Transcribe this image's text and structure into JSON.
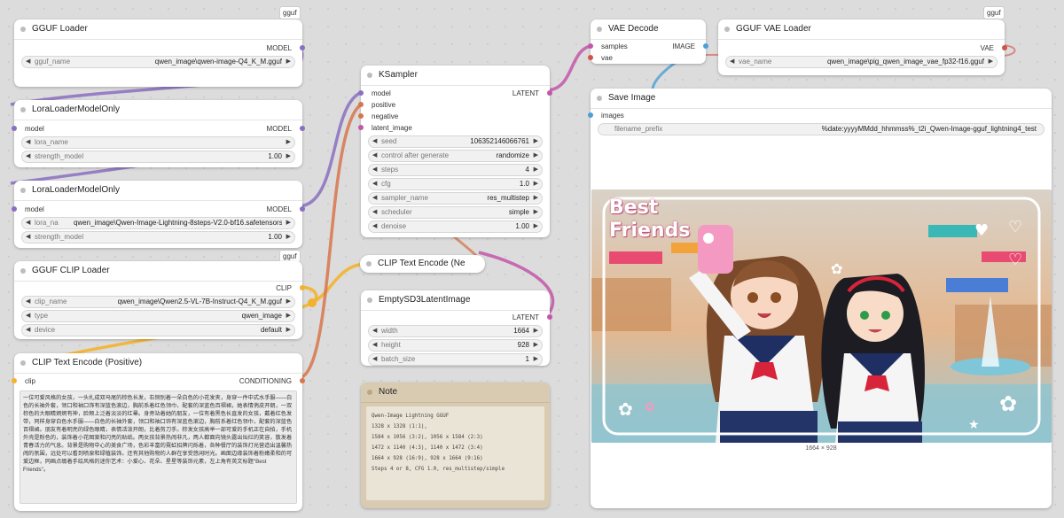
{
  "colors": {
    "model": "#8a6fc0",
    "clip": "#f3b22c",
    "conditioning": "#d7754b",
    "latent": "#c356a9",
    "vae": "#d45149",
    "image": "#4c9fd6"
  },
  "nodes": {
    "gguf_loader": {
      "badge": "gguf",
      "title": "GGUF Loader",
      "output": "MODEL",
      "widgets": [
        {
          "name": "gguf_name",
          "value": "qwen_image\\qwen-image-Q4_K_M.gguf"
        }
      ]
    },
    "lora1": {
      "title": "LoraLoaderModelOnly",
      "input": "model",
      "output": "MODEL",
      "widgets": [
        {
          "name": "lora_name",
          "value": ""
        },
        {
          "name": "strength_model",
          "value": "1.00"
        }
      ]
    },
    "lora2": {
      "title": "LoraLoaderModelOnly",
      "input": "model",
      "output": "MODEL",
      "widgets": [
        {
          "name": "lora_na",
          "value": "qwen_image\\Qwen-Image-Lightning-8steps-V2.0-bf16.safetensors"
        },
        {
          "name": "strength_model",
          "value": "1.00"
        }
      ]
    },
    "clip_loader": {
      "badge": "gguf",
      "title": "GGUF CLIP Loader",
      "output": "CLIP",
      "widgets": [
        {
          "name": "clip_name",
          "value": "qwen_image\\Qwen2.5-VL-7B-Instruct-Q4_K_M.gguf"
        },
        {
          "name": "type",
          "value": "qwen_image"
        },
        {
          "name": "device",
          "value": "default"
        }
      ]
    },
    "clip_positive": {
      "title": "CLIP Text Encode (Positive)",
      "input": "clip",
      "output": "CONDITIONING",
      "prompt": "一位可爱风格的女孩，一头扎成双马尾的棕色长发，右侧别着一朵白色的小花发夹，身穿一件中式水手服——白色的长袖外套，领口和袖口饰有深蓝色滚边，胸前系着红色领巾，配套的深蓝色百褶裙，她表情俏皮开朗，一双棕色的大眼睛炯炯有神，脸颊上泛着淡淡的红晕。身旁站着她的朋友，一位有着黑色长直发的女孩，戴着红色发带，同样身穿白色水手服——白色的长袖外套，领口和袖口饰有深蓝色滚边，胸前系着红色领巾，配套的深蓝色百褶裙。朋友有着明亮的绿色眼睛，表情活泼开朗，比着剪刀手。棕发女孩高举一部可爱的手机正在自拍，手机外壳是粉色的，装饰着小花图案和闪亮的贴纸。两女孩背景热闹非凡，两人都面向镜头露出灿烂的笑容，散发着青春活力的气息。背景是购物中心的美食广场，色彩丰富的霓虹招牌闪烁着，各种餐厅的装饰灯光营造出温馨热闹的氛围，远处可以看到喷泉和绿植装饰。还有其他购物的人群在享受悠闲时光。画面边缘装饰着粉嫩柔和的可爱边框，同画点缀着手绘风格的迷你艺术：小爱心、花朵、星星等装饰元素，左上角有英文标题\"Best Friends\"。"
    },
    "ksampler": {
      "title": "KSampler",
      "inputs": [
        "model",
        "positive",
        "negative",
        "latent_image"
      ],
      "output": "LATENT",
      "widgets": [
        {
          "name": "seed",
          "value": "106352146066761"
        },
        {
          "name": "control after generate",
          "value": "randomize"
        },
        {
          "name": "steps",
          "value": "4"
        },
        {
          "name": "cfg",
          "value": "1.0"
        },
        {
          "name": "sampler_name",
          "value": "res_multistep"
        },
        {
          "name": "scheduler",
          "value": "simple"
        },
        {
          "name": "denoise",
          "value": "1.00"
        }
      ]
    },
    "clip_negative": {
      "title": "CLIP Text Encode (Ne"
    },
    "empty_latent": {
      "title": "EmptySD3LatentImage",
      "output": "LATENT",
      "widgets": [
        {
          "name": "width",
          "value": "1664"
        },
        {
          "name": "height",
          "value": "928"
        },
        {
          "name": "batch_size",
          "value": "1"
        }
      ]
    },
    "note": {
      "title": "Note",
      "lines": [
        "Qwen-Image Lightning GGUF",
        "1328 x 1328 (1:1),",
        "1584 x 1056 (3:2),  1056 x 1584 (2:3)",
        "1472 x 1140 (4:3),  1140 x 1472 (3:4)",
        "1664 x  928 (16:9),  928 x 1664 (9:16)",
        "Steps 4 or 8, CFG 1.0, res_multistep/simple"
      ]
    },
    "vae_decode": {
      "title": "VAE Decode",
      "inputs": [
        "samples",
        "vae"
      ],
      "output": "IMAGE"
    },
    "vae_loader": {
      "badge": "gguf",
      "title": "GGUF VAE Loader",
      "output": "VAE",
      "widgets": [
        {
          "name": "vae_name",
          "value": "qwen_image\\pig_qwen_image_vae_fp32-f16.gguf"
        }
      ]
    },
    "save_image": {
      "title": "Save Image",
      "input": "images",
      "widgets": [
        {
          "name": "filename_prefix",
          "value": "%date:yyyyMMdd_hhmmss%_t2i_Qwen-Image-gguf_lightning4_test"
        }
      ],
      "image_caption": "1664 × 928",
      "image_title_line1": "Best",
      "image_title_line2": "Friends"
    }
  }
}
